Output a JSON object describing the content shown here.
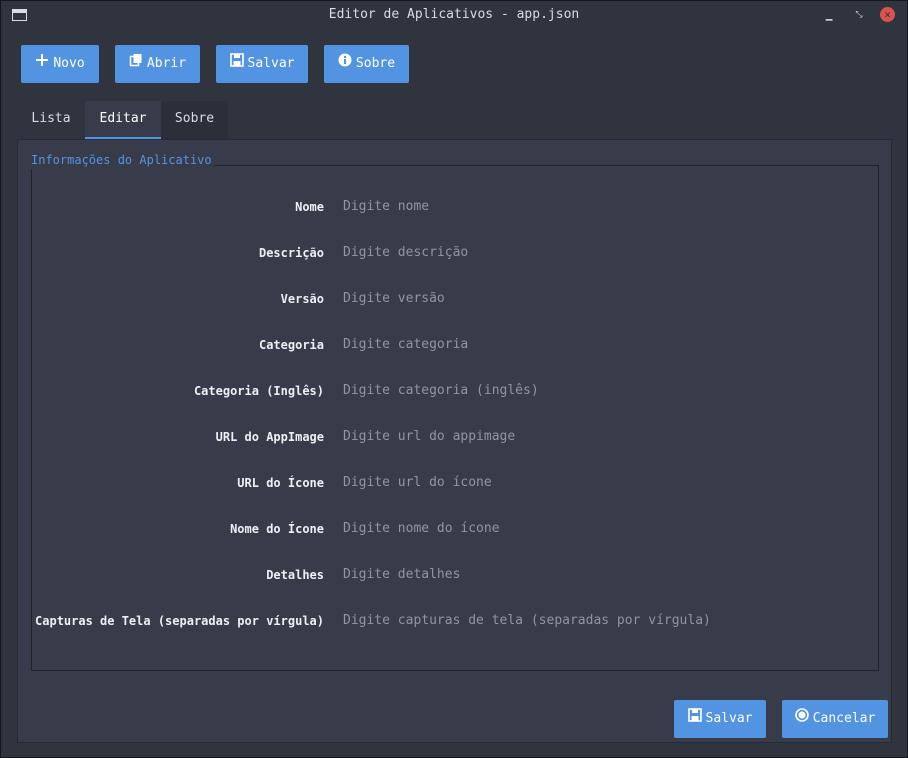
{
  "window": {
    "title": "Editor de Aplicativos - app.json"
  },
  "toolbar": {
    "new_label": "Novo",
    "open_label": "Abrir",
    "save_label": "Salvar",
    "about_label": "Sobre"
  },
  "tabs": [
    {
      "label": "Lista"
    },
    {
      "label": "Editar"
    },
    {
      "label": "Sobre"
    }
  ],
  "active_tab": "Editar",
  "group": {
    "title": "Informações do Aplicativo"
  },
  "fields": [
    {
      "label": "Nome",
      "placeholder": "Digite nome",
      "value": ""
    },
    {
      "label": "Descrição",
      "placeholder": "Digite descrição",
      "value": ""
    },
    {
      "label": "Versão",
      "placeholder": "Digite versão",
      "value": ""
    },
    {
      "label": "Categoria",
      "placeholder": "Digite categoria",
      "value": ""
    },
    {
      "label": "Categoria (Inglês)",
      "placeholder": "Digite categoria (inglês)",
      "value": ""
    },
    {
      "label": "URL do AppImage",
      "placeholder": "Digite url do appimage",
      "value": ""
    },
    {
      "label": "URL do Ícone",
      "placeholder": "Digite url do ícone",
      "value": ""
    },
    {
      "label": "Nome do Ícone",
      "placeholder": "Digite nome do ícone",
      "value": ""
    },
    {
      "label": "Detalhes",
      "placeholder": "Digite detalhes",
      "value": ""
    },
    {
      "label": "Capturas de Tela (separadas por vírgula)",
      "placeholder": "Digite capturas de tela (separadas por vírgula)",
      "value": ""
    }
  ],
  "actions": {
    "save_label": "Salvar",
    "cancel_label": "Cancelar"
  },
  "colors": {
    "accent": "#5294e2",
    "window_bg": "#2f343f",
    "panel_bg": "#383c4a",
    "close_button": "#d9534f"
  },
  "icons": {
    "app": "window-icon",
    "minimize": "minimize-icon",
    "maximize": "restore-icon",
    "close": "close-icon",
    "new": "plus-icon",
    "open": "open-file-icon",
    "save": "floppy-disk-icon",
    "about": "info-icon",
    "cancel": "cancel-circle-icon"
  }
}
